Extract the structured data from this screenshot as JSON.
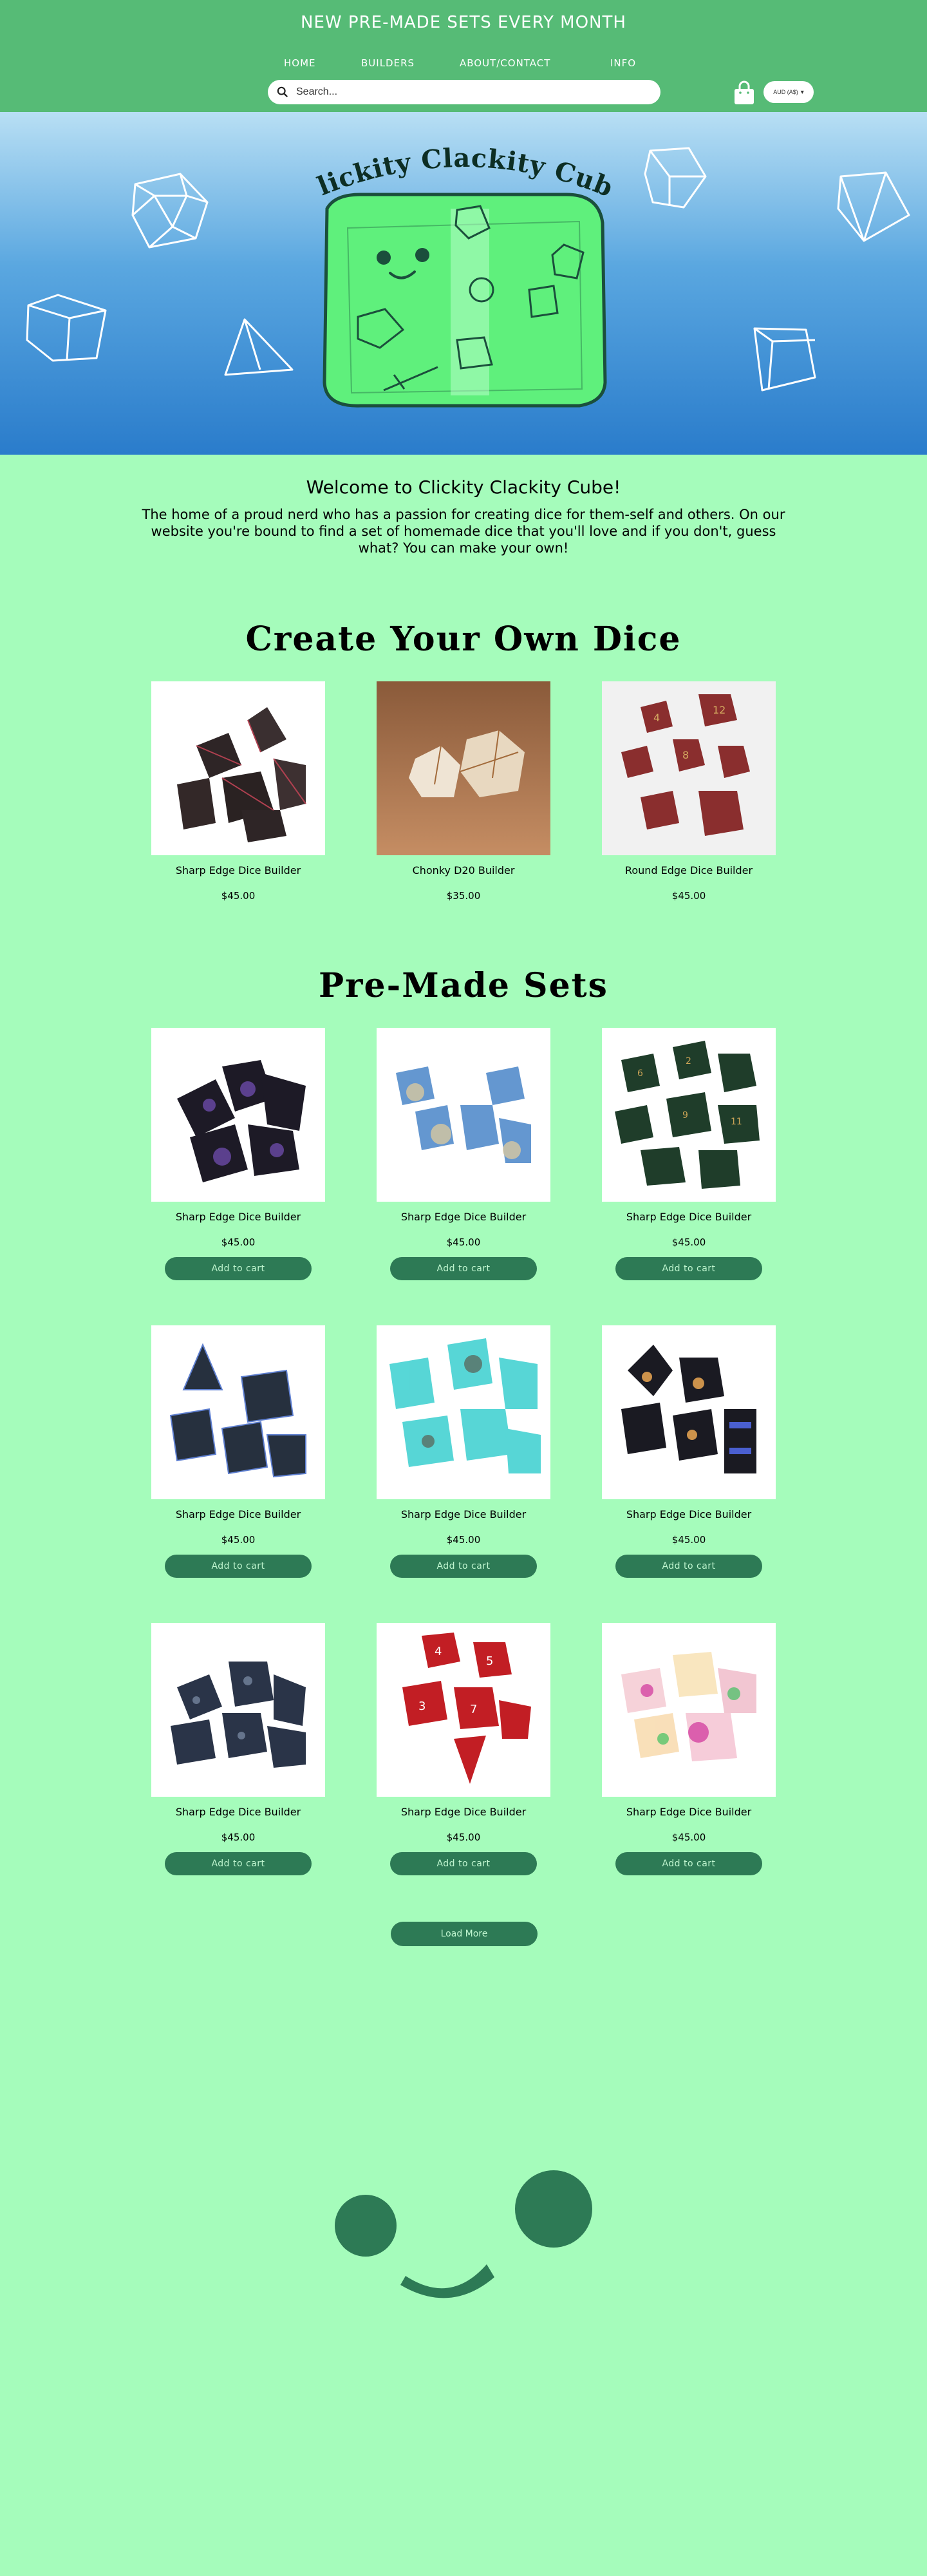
{
  "header": {
    "announcement": "NEW PRE-MADE SETS EVERY MONTH",
    "nav": [
      {
        "label": "HOME"
      },
      {
        "label": "BUILDERS"
      },
      {
        "label": "ABOUT/CONTACT"
      },
      {
        "label": "INFO"
      }
    ],
    "search_placeholder": "Search...",
    "currency": "AUD (A$)",
    "colors": {
      "bar": "#56bb76",
      "button": "#2d7a55",
      "page": "#a5fcbb"
    }
  },
  "hero": {
    "logo_text": "Clickity Clackity Cube"
  },
  "welcome": {
    "title": "Welcome to Clickity Clackity Cube!",
    "text": "The home of a proud nerd who has a passion for creating dice for them-self and others. On our website you're bound to find a set of homemade dice that you'll love and if you don't, guess what? You can make your own!"
  },
  "builders": {
    "title": "Create Your Own Dice",
    "items": [
      {
        "name": "Sharp Edge Dice Builder",
        "price": "$45.00"
      },
      {
        "name": "Chonky D20 Builder",
        "price": "$35.00"
      },
      {
        "name": "Round Edge Dice Builder",
        "price": "$45.00"
      }
    ]
  },
  "premade": {
    "title": "Pre-Made Sets",
    "add_label": "Add to cart",
    "items": [
      {
        "name": "Sharp Edge Dice Builder",
        "price": "$45.00"
      },
      {
        "name": "Sharp Edge Dice Builder",
        "price": "$45.00"
      },
      {
        "name": "Sharp Edge Dice Builder",
        "price": "$45.00"
      },
      {
        "name": "Sharp Edge Dice Builder",
        "price": "$45.00"
      },
      {
        "name": "Sharp Edge Dice Builder",
        "price": "$45.00"
      },
      {
        "name": "Sharp Edge Dice Builder",
        "price": "$45.00"
      },
      {
        "name": "Sharp Edge Dice Builder",
        "price": "$45.00"
      },
      {
        "name": "Sharp Edge Dice Builder",
        "price": "$45.00"
      },
      {
        "name": "Sharp Edge Dice Builder",
        "price": "$45.00"
      }
    ],
    "load_more": "Load More"
  }
}
